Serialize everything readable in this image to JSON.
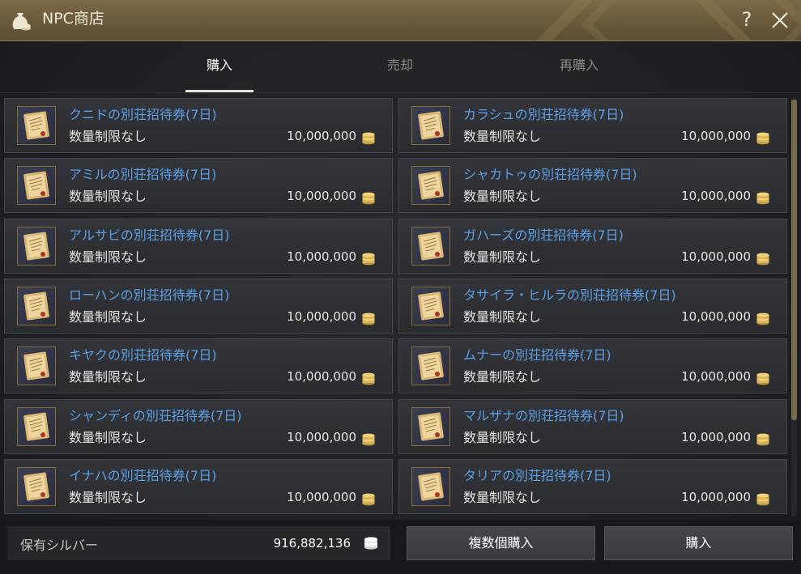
{
  "window": {
    "title": "NPC商店",
    "help_label": "?"
  },
  "tabs": [
    {
      "label": "購入",
      "active": true
    },
    {
      "label": "売却",
      "active": false
    },
    {
      "label": "再購入",
      "active": false
    }
  ],
  "items": [
    {
      "name": "クニドの別荘招待券(7日)",
      "limit": "数量制限なし",
      "price": "10,000,000"
    },
    {
      "name": "カラシュの別荘招待券(7日)",
      "limit": "数量制限なし",
      "price": "10,000,000"
    },
    {
      "name": "アミルの別荘招待券(7日)",
      "limit": "数量制限なし",
      "price": "10,000,000"
    },
    {
      "name": "シャカトゥの別荘招待券(7日)",
      "limit": "数量制限なし",
      "price": "10,000,000"
    },
    {
      "name": "アルサビの別荘招待券(7日)",
      "limit": "数量制限なし",
      "price": "10,000,000"
    },
    {
      "name": "ガハーズの別荘招待券(7日)",
      "limit": "数量制限なし",
      "price": "10,000,000"
    },
    {
      "name": "ローハンの別荘招待券(7日)",
      "limit": "数量制限なし",
      "price": "10,000,000"
    },
    {
      "name": "タサイラ・ヒルラの別荘招待券(7日)",
      "limit": "数量制限なし",
      "price": "10,000,000"
    },
    {
      "name": "キヤクの別荘招待券(7日)",
      "limit": "数量制限なし",
      "price": "10,000,000"
    },
    {
      "name": "ムナーの別荘招待券(7日)",
      "limit": "数量制限なし",
      "price": "10,000,000"
    },
    {
      "name": "シャンディの別荘招待券(7日)",
      "limit": "数量制限なし",
      "price": "10,000,000"
    },
    {
      "name": "マルザナの別荘招待券(7日)",
      "limit": "数量制限なし",
      "price": "10,000,000"
    },
    {
      "name": "イナハの別荘招待券(7日)",
      "limit": "数量制限なし",
      "price": "10,000,000"
    },
    {
      "name": "タリアの別荘招待券(7日)",
      "limit": "数量制限なし",
      "price": "10,000,000"
    }
  ],
  "footer": {
    "silver_label": "保有シルバー",
    "silver_value": "916,882,136",
    "bulk_buy_label": "複数個購入",
    "buy_label": "購入"
  },
  "colors": {
    "title_bar": "#6a5a3c",
    "item_name": "#5aa0e6",
    "coin": "#d9b45a",
    "scroll_thumb": "#7a6a4c"
  },
  "icons": {
    "window": "money-bag-icon",
    "help": "help-icon",
    "close": "close-icon",
    "item": "scroll-ticket-icon",
    "currency": "silver-coin-stack-icon"
  }
}
